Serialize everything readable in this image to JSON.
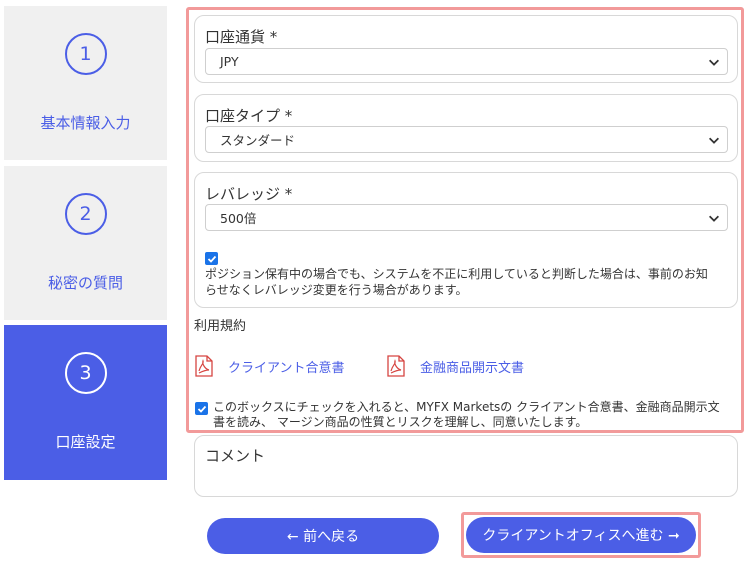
{
  "stepper": {
    "steps": [
      {
        "number": "1",
        "label": "基本情報入力"
      },
      {
        "number": "2",
        "label": "秘密の質問"
      },
      {
        "number": "3",
        "label": "口座設定"
      }
    ]
  },
  "form": {
    "currency": {
      "label": "口座通貨 *",
      "value": "JPY"
    },
    "account_type": {
      "label": "口座タイプ *",
      "value": "スタンダード"
    },
    "leverage": {
      "label": "レバレッジ *",
      "value": "500倍",
      "notice_line1": "ポジション保有中の場合でも、システムを不正に利用していると判断した場合は、事前のお知",
      "notice_line2": "らせなくレバレッジ変更を行う場合があります。"
    },
    "terms": {
      "heading": "利用規約",
      "links": [
        "クライアント合意書",
        "金融商品開示文書"
      ],
      "agree_line1": "このボックスにチェックを入れると、MYFX Marketsの クライアント合意書、金融商品開示文",
      "agree_line2": "書を読み、 マージン商品の性質とリスクを理解し、同意いたします。"
    },
    "comment": {
      "label": "コメント"
    }
  },
  "buttons": {
    "back": "← 前へ戻る",
    "next": "クライアントオフィスへ進む ➞"
  },
  "colors": {
    "accent": "#4b5ee6",
    "highlight": "#f29a9a",
    "checkbox": "#1a73e8"
  }
}
